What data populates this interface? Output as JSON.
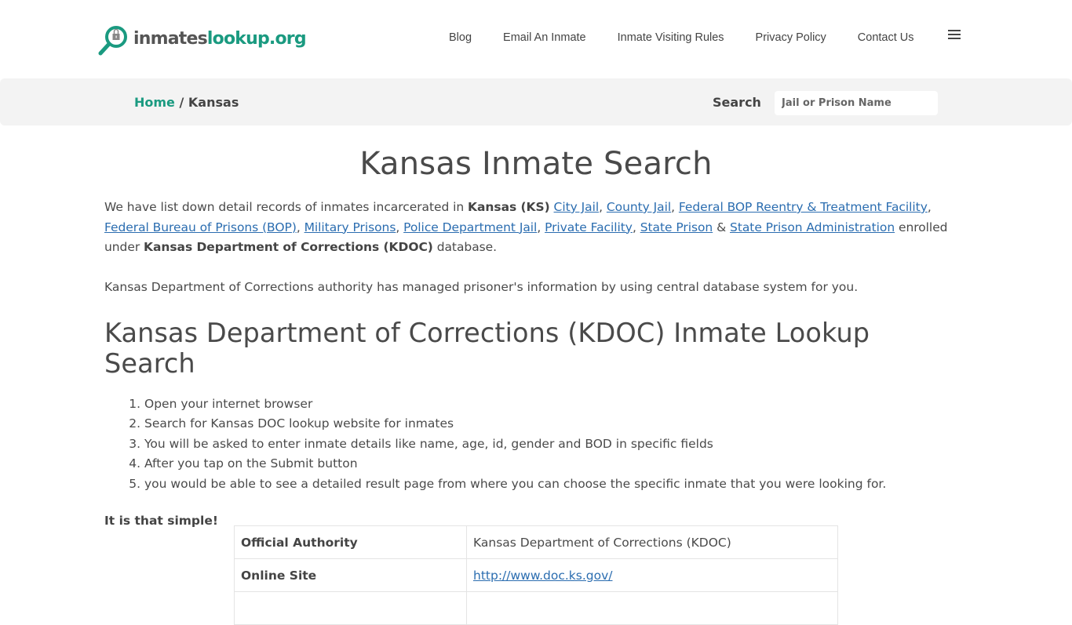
{
  "header": {
    "logo": {
      "part1": "inmates",
      "part2": "lookup.org",
      "icon": "magnifier-lock-icon"
    },
    "nav": [
      {
        "label": "Blog"
      },
      {
        "label": "Email An Inmate"
      },
      {
        "label": "Inmate Visiting Rules"
      },
      {
        "label": "Privacy Policy"
      },
      {
        "label": "Contact Us"
      }
    ],
    "menu_icon": "hamburger-icon"
  },
  "breadcrumb": {
    "home": "Home",
    "separator": "/",
    "current": "Kansas"
  },
  "search": {
    "label": "Search",
    "placeholder": "Jail or Prison Name",
    "value": ""
  },
  "main": {
    "title": "Kansas Inmate Search",
    "intro": {
      "lead": "We have list down detail records of inmates incarcerated in ",
      "state": "Kansas (KS)",
      "links": [
        "City Jail",
        "County Jail",
        "Federal BOP Reentry & Treatment Facility",
        "Federal Bureau of Prisons (BOP)",
        "Military Prisons",
        "Police Department Jail",
        "Private Facility",
        "State Prison",
        "State Prison Administration"
      ],
      "amp": "&",
      "enrolled": " enrolled under ",
      "department": "Kansas Department of Corrections (KDOC)",
      "tail": " database."
    },
    "note": "Kansas Department of Corrections authority has managed prisoner's information by using central database system for you.",
    "subtitle": "Kansas Department of Corrections (KDOC) Inmate Lookup Search",
    "steps": [
      "Open your internet browser",
      "Search for Kansas DOC lookup website for inmates",
      "You will be asked to enter inmate details like name, age, id, gender and BOD in specific fields",
      "After you tap on the Submit button",
      "you would be able to see a detailed result page from where you can choose the specific inmate that you were looking for."
    ],
    "simple": "It is that simple!",
    "table": [
      {
        "key": "Official Authority",
        "value": "Kansas Department of Corrections (KDOC)",
        "link": false
      },
      {
        "key": "Online Site",
        "value": "http://www.doc.ks.gov/",
        "link": true
      },
      {
        "key": "",
        "value": "",
        "link": false
      }
    ]
  },
  "colors": {
    "brand": "#1a9a80",
    "link": "#2b6db0",
    "text": "#4a4a4a",
    "bar": "#f3f3f3"
  }
}
